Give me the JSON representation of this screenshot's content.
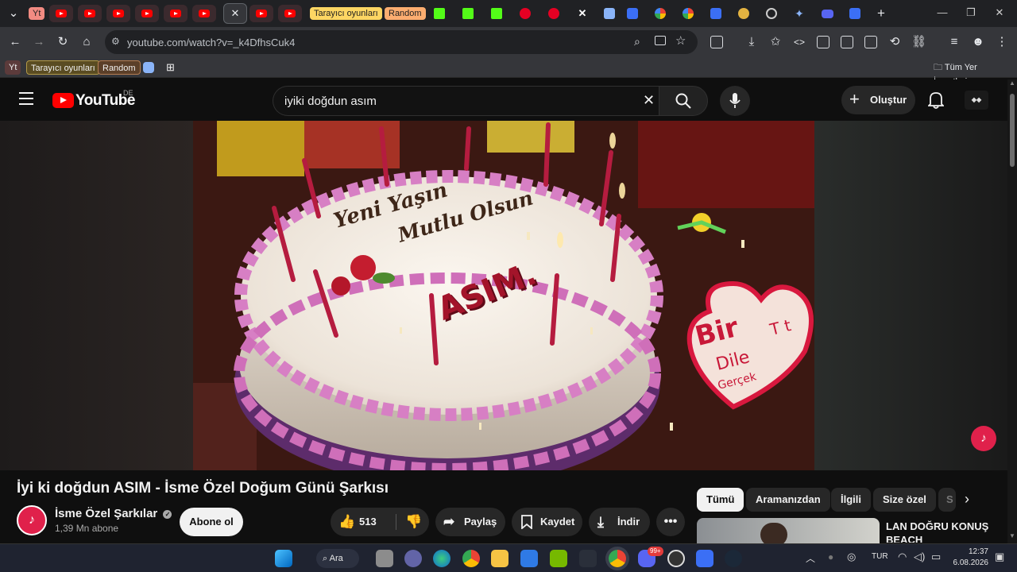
{
  "browser": {
    "tab_chips": [
      {
        "label": "Yt",
        "color": "#f28b82"
      },
      {
        "label": "Tarayıcı oyunları",
        "color": "#fdd663"
      },
      {
        "label": "Random",
        "color": "#fcad70"
      }
    ],
    "address": {
      "url": "youtube.com/watch?v=_k4DfhsCuk4"
    },
    "bookmarks": {
      "items": [
        "Yt",
        "Tarayıcı oyunları",
        "Random"
      ],
      "all_bookmarks_label": "Tüm Yer İşaretleri"
    }
  },
  "youtube": {
    "logo_text": "YouTube",
    "region": "DE",
    "search": {
      "value": "iyiki doğdun asım",
      "placeholder": "Ara"
    },
    "create_label": "Oluştur",
    "video": {
      "title": "İyi ki doğdun ASIM - İsme Özel Doğum Günü Şarkısı",
      "overlay": {
        "cake_line1": "Yeni Yaşın",
        "cake_line2": "Mutlu Olsun",
        "cake_name": "ASIM.",
        "heart_line1": "Bir",
        "heart_line2": "Dile",
        "heart_line3": "Gerçek",
        "heart_line4": "T t"
      }
    },
    "channel": {
      "name": "İsme Özel Şarkılar",
      "subscribers": "1,39 Mn abone",
      "subscribe_label": "Abone ol"
    },
    "actions": {
      "like_count": "513",
      "share_label": "Paylaş",
      "save_label": "Kaydet",
      "download_label": "İndir"
    },
    "chips": [
      "Tümü",
      "Aramanızdan",
      "İlgili",
      "Size özel",
      "S"
    ],
    "related": {
      "title_line1": "LAN DOĞRU KONUŞ",
      "title_line2": "BEACH"
    }
  },
  "taskbar": {
    "search_label": "Ara",
    "language": "TUR",
    "time": "12:37",
    "date": "6.08.2026",
    "badge": "99+"
  },
  "colors": {
    "yt_red": "#ff0000",
    "page_bg": "#0f0f0f",
    "pill_bg": "#272727",
    "channel_avatar": "#e0214b"
  }
}
